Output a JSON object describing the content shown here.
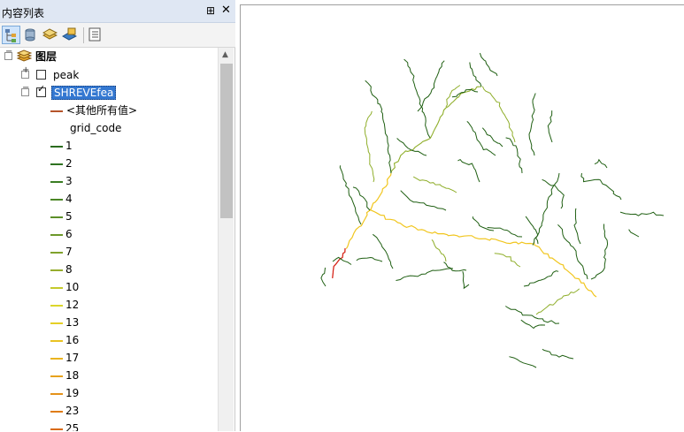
{
  "toc": {
    "title": "内容列表",
    "pin_icon": "⊞",
    "close_icon": "✕",
    "tree": {
      "root_label": "图层",
      "layers": [
        {
          "name": "peak",
          "checked": false,
          "expanded": false
        },
        {
          "name": "SHREVEfea",
          "checked": true,
          "expanded": true,
          "selected": true
        }
      ],
      "other_values_label": "<其他所有值>",
      "field_heading": "grid_code",
      "legend_items": [
        {
          "label": "1",
          "color": "#2a6b1e"
        },
        {
          "label": "2",
          "color": "#2e7220"
        },
        {
          "label": "3",
          "color": "#3a7d23"
        },
        {
          "label": "4",
          "color": "#4b8626"
        },
        {
          "label": "5",
          "color": "#5c8f28"
        },
        {
          "label": "6",
          "color": "#6c982a"
        },
        {
          "label": "7",
          "color": "#80a22c"
        },
        {
          "label": "8",
          "color": "#96ad2d"
        },
        {
          "label": "10",
          "color": "#c4c92c"
        },
        {
          "label": "12",
          "color": "#dcd62b"
        },
        {
          "label": "13",
          "color": "#e5cf26"
        },
        {
          "label": "16",
          "color": "#e9c222"
        },
        {
          "label": "17",
          "color": "#eab41f"
        },
        {
          "label": "18",
          "color": "#e7a21c"
        },
        {
          "label": "19",
          "color": "#e4921a"
        },
        {
          "label": "23",
          "color": "#df7c17"
        },
        {
          "label": "25",
          "color": "#d96a14"
        }
      ]
    }
  },
  "colors": {
    "stream_low": "#1f5f12",
    "stream_mid": "#8fae2a",
    "stream_high": "#f1c61f",
    "stream_max": "#d7261b",
    "other_values_symbol": "#b5542a"
  }
}
